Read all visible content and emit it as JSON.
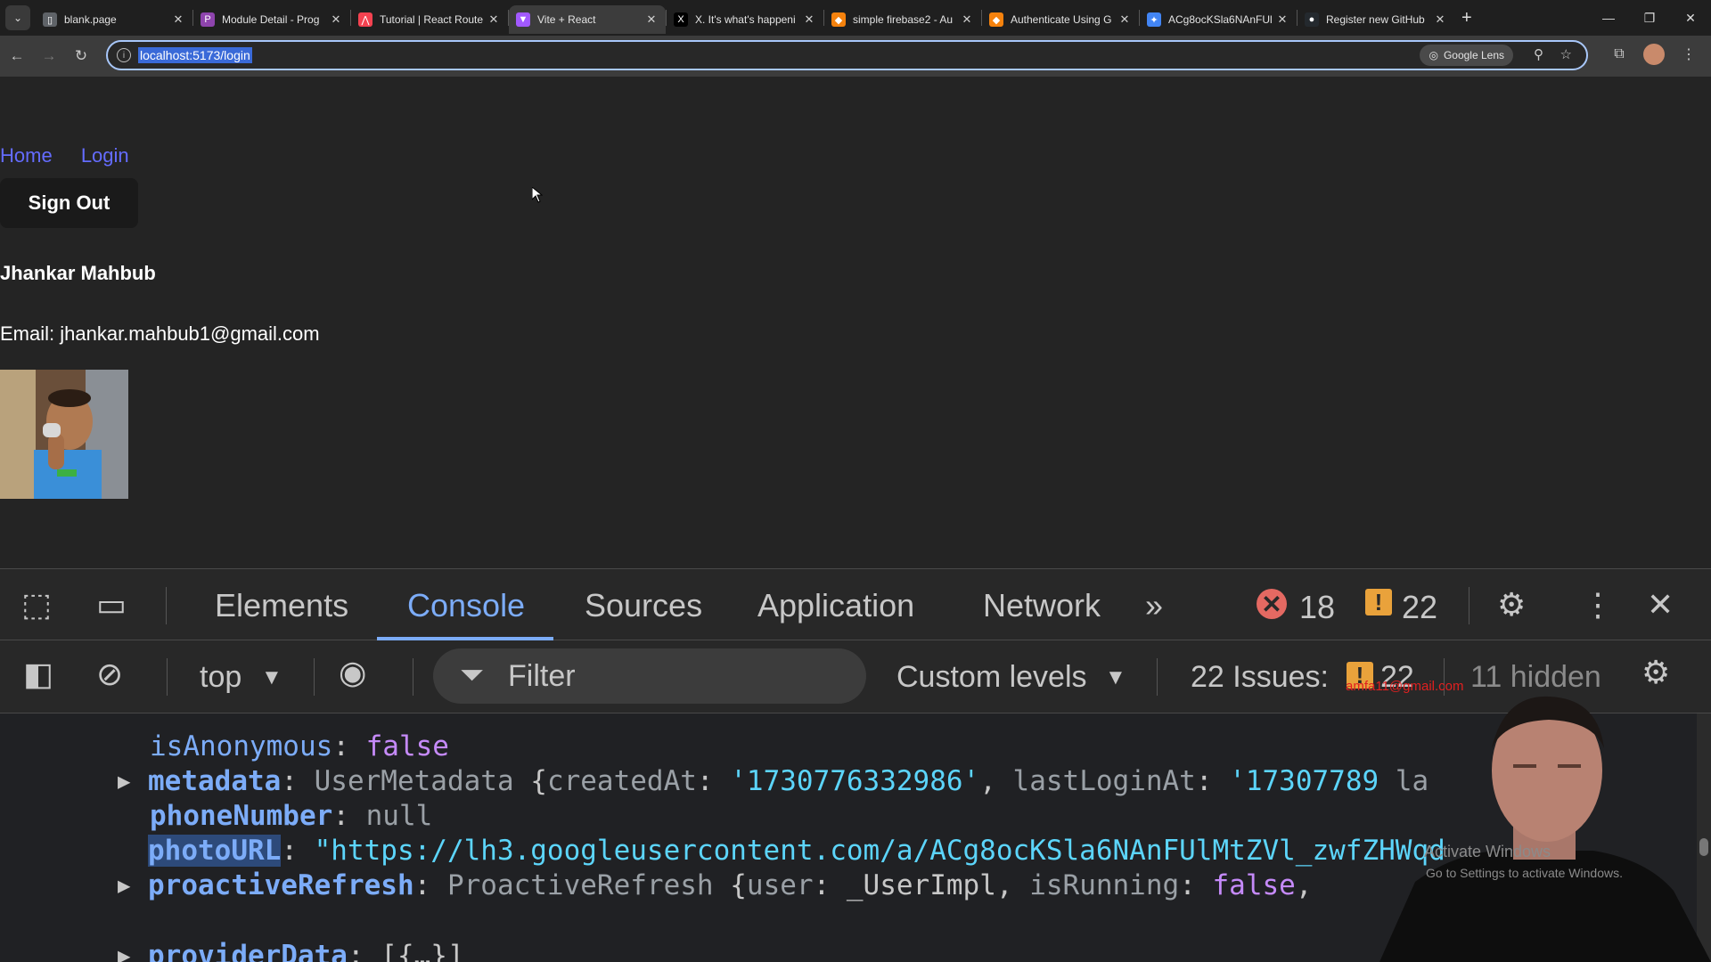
{
  "browser": {
    "tabs": [
      {
        "title": "blank.page",
        "icon": "page-icon",
        "active": false
      },
      {
        "title": "Module Detail - Prog",
        "icon": "purple-p-icon",
        "active": false
      },
      {
        "title": "Tutorial | React Route",
        "icon": "react-router-icon",
        "active": false
      },
      {
        "title": "Vite + React",
        "icon": "vite-icon",
        "active": true
      },
      {
        "title": "X. It's what's happeni",
        "icon": "x-logo-icon",
        "active": false
      },
      {
        "title": "simple firebase2 - Au",
        "icon": "firebase-icon",
        "active": false
      },
      {
        "title": "Authenticate Using G",
        "icon": "firebase-icon",
        "active": false
      },
      {
        "title": "ACg8ocKSla6NAnFUl",
        "icon": "google-icon",
        "active": false
      },
      {
        "title": "Register new GitHub",
        "icon": "github-icon",
        "active": false
      }
    ],
    "url": "localhost:5173/login",
    "lens_label": "Google Lens"
  },
  "page": {
    "nav": {
      "home": "Home",
      "login": "Login"
    },
    "signout_label": "Sign Out",
    "user_name": "Jhankar Mahbub",
    "email_text": "Email: jhankar.mahbub1@gmail.com"
  },
  "devtools": {
    "tabs": {
      "elements": "Elements",
      "console": "Console",
      "sources": "Sources",
      "application": "Application",
      "network": "Network"
    },
    "error_count": "18",
    "warning_count": "22",
    "context": "top",
    "filter_placeholder": "Filter",
    "levels": "Custom levels",
    "issues_label": "22 Issues:",
    "issues_count": "22",
    "hidden_label": "11 hidden"
  },
  "console": {
    "isAnonymous": {
      "key": "isAnonymous",
      "value": "false"
    },
    "metadata": {
      "key": "metadata",
      "class": "UserMetadata",
      "k1": "createdAt",
      "v1": "'1730776332986'",
      "k2": "lastLoginAt",
      "v2": "'17307789",
      "tail": "la"
    },
    "phoneNumber": {
      "key": "phoneNumber",
      "value": "null"
    },
    "photoURL": {
      "key": "photoURL",
      "value": "\"https://lh3.googleusercontent.com/a/ACg8ocKSla6NAnFUlMtZVl_zwfZH"
    },
    "photoURL_tail": "Wqd",
    "proactiveRefresh": {
      "key": "proactiveRefresh",
      "class": "ProactiveRefresh",
      "k1": "user",
      "v1": "_UserImpl",
      "k2": "isRunning",
      "v2": "false"
    },
    "providerData": {
      "key": "providerData",
      "value": "[{…}]"
    }
  },
  "overlay": {
    "activate_title": "Activate Windows",
    "activate_sub": "Go to Settings to activate Windows.",
    "email_fragment": "amfa11@gmail.com"
  },
  "colors": {
    "link": "#646cff",
    "devtools_accent": "#7cacf8",
    "error": "#e46962",
    "warning": "#e9a23b",
    "url_highlight": "#3a6ad8"
  }
}
